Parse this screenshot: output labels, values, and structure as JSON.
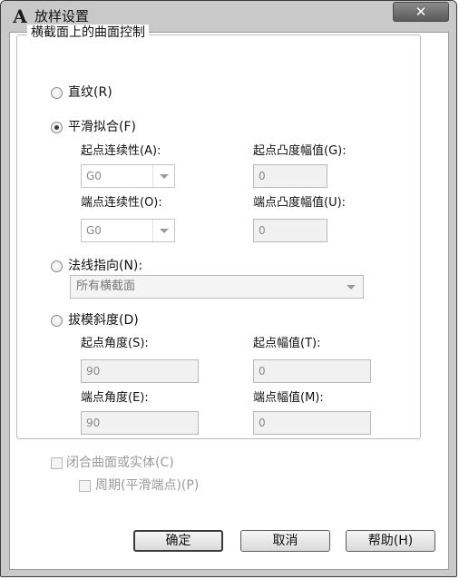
{
  "window": {
    "title": "放样设置",
    "app_icon": "A",
    "close_glyph": "✕"
  },
  "group": {
    "title": "横截面上的曲面控制"
  },
  "options": {
    "ruled": {
      "label": "直纹(R)",
      "selected": false
    },
    "smooth": {
      "label": "平滑拟合(F)",
      "selected": true,
      "start_continuity_label": "起点连续性(A):",
      "start_continuity_value": "G0",
      "start_bulge_label": "起点凸度幅值(G):",
      "start_bulge_value": "0",
      "end_continuity_label": "端点连续性(O):",
      "end_continuity_value": "G0",
      "end_bulge_label": "端点凸度幅值(U):",
      "end_bulge_value": "0"
    },
    "normal": {
      "label": "法线指向(N):",
      "selected": false,
      "dropdown_value": "所有横截面"
    },
    "draft": {
      "label": "拔模斜度(D)",
      "selected": false,
      "start_angle_label": "起点角度(S):",
      "start_angle_value": "90",
      "start_magnitude_label": "起点幅值(T):",
      "start_magnitude_value": "0",
      "end_angle_label": "端点角度(E):",
      "end_angle_value": "90",
      "end_magnitude_label": "端点幅值(M):",
      "end_magnitude_value": "0"
    }
  },
  "checks": {
    "close_surface": {
      "label": "闭合曲面或实体(C)",
      "checked": false
    },
    "periodic": {
      "label": "周期(平滑端点)(P)",
      "checked": false
    }
  },
  "buttons": {
    "ok": "确定",
    "cancel": "取消",
    "help": "帮助(H)"
  }
}
